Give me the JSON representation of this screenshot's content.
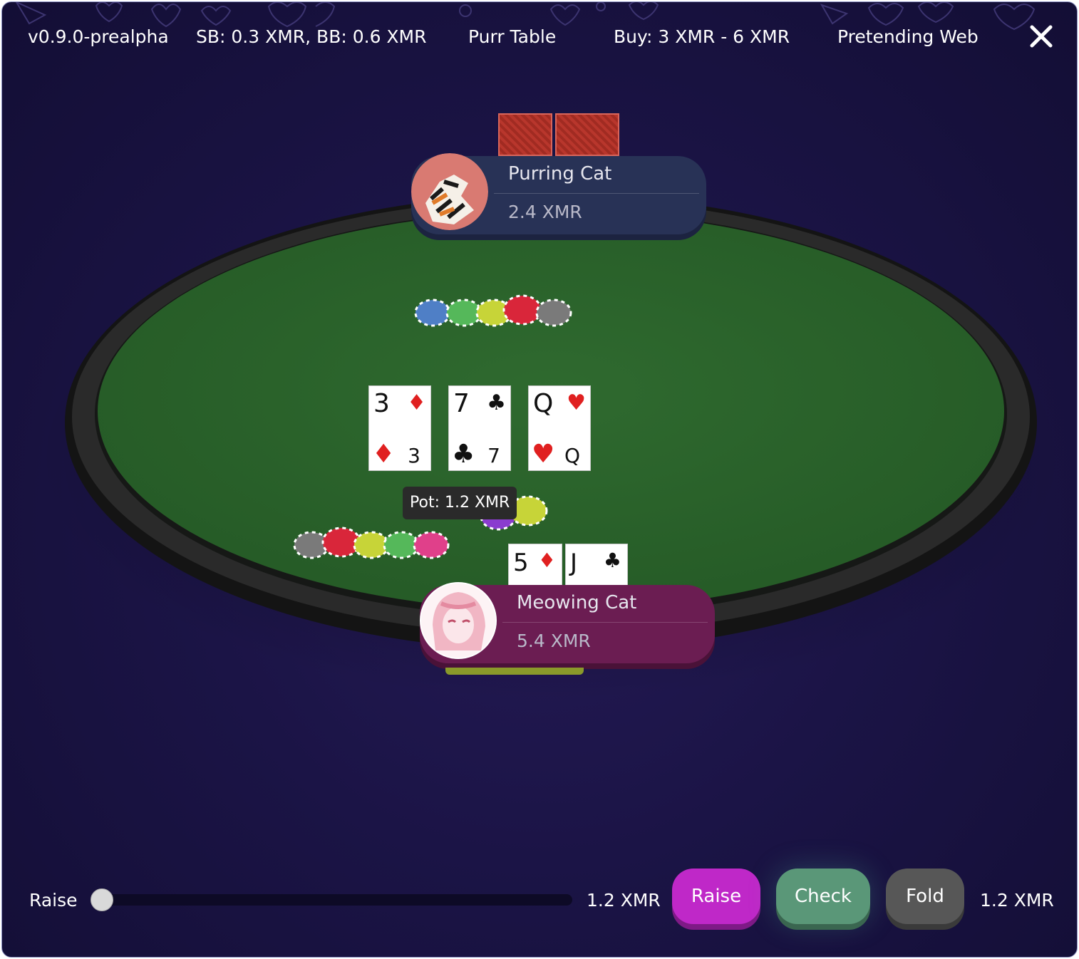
{
  "topbar": {
    "version": "v0.9.0-prealpha",
    "blinds": "SB: 0.3 XMR, BB: 0.6 XMR",
    "table_name": "Purr Table",
    "buy_in": "Buy: 3 XMR - 6 XMR",
    "mode": "Pretending Web",
    "close_icon": "close-icon"
  },
  "opponent": {
    "name": "Purring Cat",
    "stack": "2.4 XMR",
    "color": "#283256"
  },
  "hero": {
    "name": "Meowing Cat",
    "stack": "5.4 XMR",
    "color": "#6b1d52",
    "hole_cards": [
      {
        "rank": "5",
        "suit": "♦"
      },
      {
        "rank": "J",
        "suit": "♣"
      }
    ]
  },
  "board": {
    "cards": [
      {
        "rank": "3",
        "suit": "♦"
      },
      {
        "rank": "7",
        "suit": "♣"
      },
      {
        "rank": "Q",
        "suit": "♥"
      }
    ]
  },
  "pot": {
    "label": "Pot: 1.2 XMR"
  },
  "actions": {
    "raise_label": "Raise",
    "min_amount": "1.2 XMR",
    "max_amount": "1.2 XMR",
    "raise_button": "Raise",
    "check_button": "Check",
    "fold_button": "Fold",
    "raise_color": "#bf28c8",
    "check_color": "#5a9778",
    "fold_color": "#575757"
  }
}
